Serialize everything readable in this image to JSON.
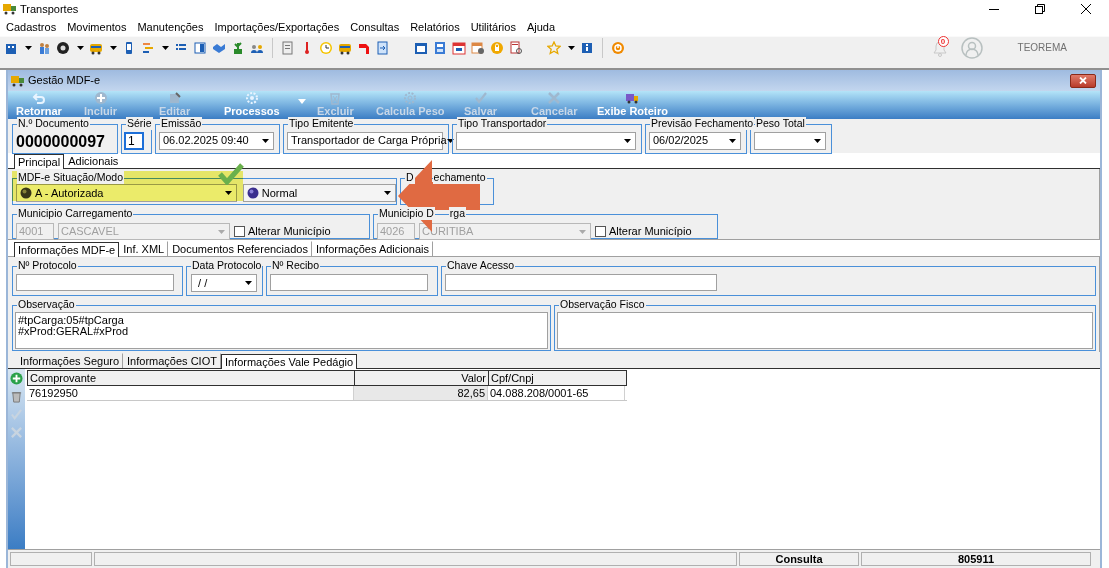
{
  "window": {
    "title": "Transportes"
  },
  "menu": [
    "Cadastros",
    "Movimentos",
    "Manutenções",
    "Importações/Exportações",
    "Consultas",
    "Relatórios",
    "Utilitários",
    "Ajuda"
  ],
  "toolbar_right": {
    "notifications": "0",
    "user": "TEOREMA"
  },
  "child_window": {
    "title": "Gestão MDF-e"
  },
  "ribbon": [
    {
      "kind": "back",
      "label": "Retornar",
      "disabled": false
    },
    {
      "kind": "add",
      "label": "Incluir",
      "disabled": true
    },
    {
      "kind": "edit",
      "label": "Editar",
      "disabled": true
    },
    {
      "kind": "process",
      "label": "Processos",
      "disabled": false
    },
    {
      "kind": "delete",
      "label": "Excluir",
      "disabled": true
    },
    {
      "kind": "weight",
      "label": "Calcula Peso",
      "disabled": true
    },
    {
      "kind": "save",
      "label": "Salvar",
      "disabled": true
    },
    {
      "kind": "cancel",
      "label": "Cancelar",
      "disabled": true
    },
    {
      "kind": "route",
      "label": "Exibe Roteiro",
      "disabled": false
    }
  ],
  "header": [
    {
      "kind": "number",
      "label": "N.º Documento",
      "value": "0000000097"
    },
    {
      "kind": "spin",
      "label": "Série",
      "value": "1"
    },
    {
      "kind": "combo",
      "label": "Emissão",
      "value": "06.02.2025 09:40"
    },
    {
      "kind": "combo",
      "label": "Tipo Emitente",
      "value": "Transportador de Carga Própria"
    },
    {
      "kind": "combo",
      "label": "Tipo Transportador"
    },
    {
      "kind": "combo",
      "label": "Previsão Fechamento",
      "value": "06/02/2025"
    },
    {
      "kind": "combo",
      "label": "Peso Total"
    }
  ],
  "main_tabs": [
    {
      "label": "Principal",
      "selected": true
    },
    {
      "label": "Adicionais",
      "selected": false
    }
  ],
  "situacao": {
    "label": "MDF-e Situação/Modo",
    "situacao": "A - Autorizada",
    "modo": "Normal"
  },
  "data_fechamento": {
    "label_parts": [
      "D",
      "echamento"
    ]
  },
  "carregamento": {
    "label_parts": [
      "Municipio Carregamento"
    ],
    "code": "4001",
    "city": "CASCAVEL",
    "alterar": {
      "label": "Alterar Município",
      "checked": false
    }
  },
  "descarga": {
    "label_parts": [
      "Municipio D",
      "rga"
    ],
    "code": "4026",
    "city": "CURITIBA",
    "alterar": {
      "label": "Alterar Município",
      "checked": false
    }
  },
  "info_tabs": [
    {
      "label": "Informações MDF-e",
      "selected": true
    },
    {
      "label": "Inf. XML",
      "selected": false
    },
    {
      "label": "Documentos Referenciados",
      "selected": false
    },
    {
      "label": "Informações Adicionais",
      "selected": false
    }
  ],
  "protocolo": [
    {
      "kind": "text",
      "label": "Nº Protocolo"
    },
    {
      "kind": "combo",
      "label": "Data Protocolo",
      "value": " / /"
    },
    {
      "kind": "text",
      "label": "Nº Recibo"
    },
    {
      "kind": "text",
      "label": "Chave Acesso"
    }
  ],
  "observacao": {
    "label": "Observação",
    "lines": [
      "#tpCarga:05#tpCarga",
      "#xProd:GERAL#xProd"
    ]
  },
  "observacao_fisco": {
    "label": "Observação Fisco"
  },
  "lower_tabs": [
    {
      "label": "Informações Seguro",
      "selected": false
    },
    {
      "label": "Informações CIOT",
      "selected": false
    },
    {
      "label": "Informações Vale Pedágio",
      "selected": true
    }
  ],
  "table": {
    "columns": [
      "Comprovante",
      "Valor",
      "Cpf/Cnpj"
    ],
    "rows": [
      [
        "76192950",
        "82,65",
        "04.088.208/0001-65"
      ]
    ]
  },
  "status_bar": {
    "mode": "Consulta",
    "code": "805911"
  }
}
